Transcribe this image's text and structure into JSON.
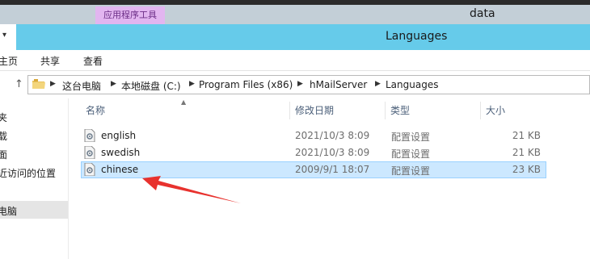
{
  "window": {
    "tools_tab": "应用程序工具",
    "title_top": "data",
    "title": "Languages"
  },
  "ribbon": {
    "tabs": [
      "主页",
      "共享",
      "查看"
    ]
  },
  "address_bar": {
    "crumbs": [
      "这台电脑",
      "本地磁盘 (C:)",
      "Program Files (x86)",
      "hMailServer",
      "Languages"
    ]
  },
  "sidebar": {
    "items": [
      "夹",
      "载",
      "面",
      "近访问的位置",
      "电脑"
    ]
  },
  "columns": [
    "名称",
    "修改日期",
    "类型",
    "大小"
  ],
  "files": [
    {
      "name": "english",
      "modified": "2021/10/3 8:09",
      "type": "配置设置",
      "size": "21 KB"
    },
    {
      "name": "swedish",
      "modified": "2021/10/3 8:09",
      "type": "配置设置",
      "size": "21 KB"
    },
    {
      "name": "chinese",
      "modified": "2009/9/1 18:07",
      "type": "配置设置",
      "size": "23 KB"
    }
  ],
  "colors": {
    "title_bar": "#66cbea",
    "tools_tab": "#e2b5f0",
    "selection": "#cce8ff",
    "annotation_arrow": "#e8322e"
  }
}
